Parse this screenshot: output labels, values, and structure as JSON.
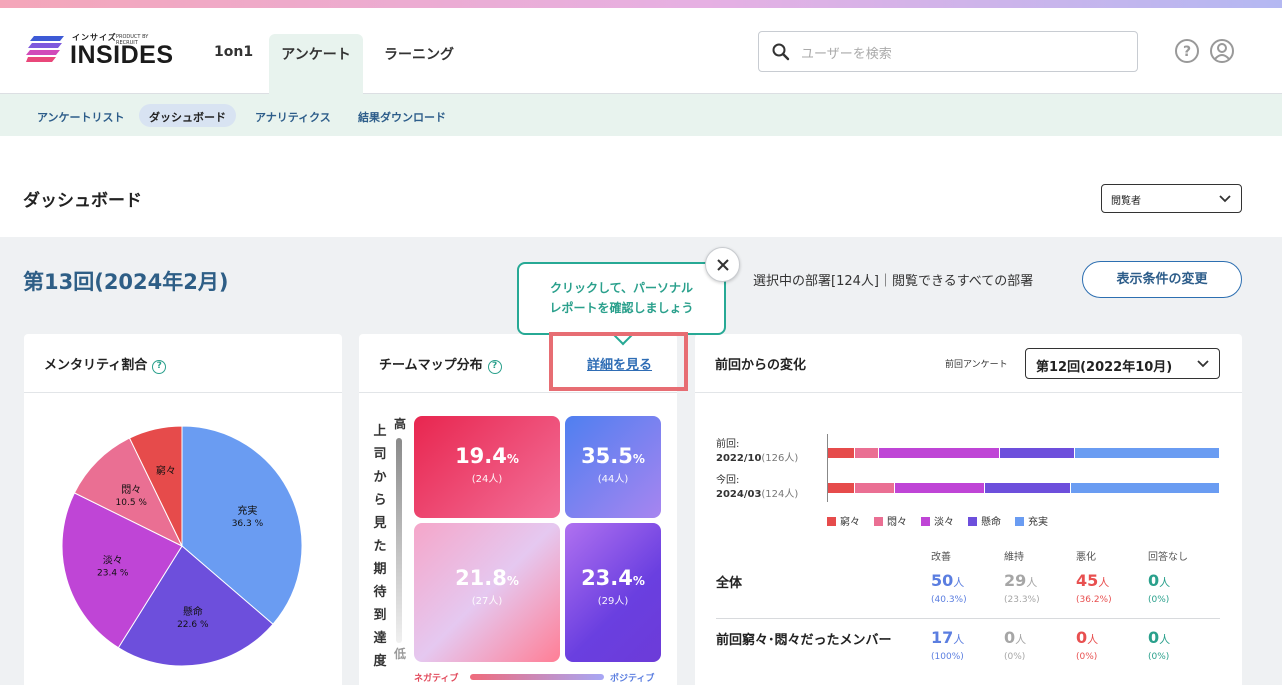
{
  "app": {
    "logo_kana": "インサイズ",
    "logo_word": "INSIDES",
    "logo_by": "PRODUCT BY RECRUIT"
  },
  "nav": {
    "tabs": [
      {
        "label": "1on1"
      },
      {
        "label": "アンケート"
      },
      {
        "label": "ラーニング"
      }
    ]
  },
  "search": {
    "placeholder": "ユーザーを検索"
  },
  "subnav": {
    "items": [
      {
        "label": "アンケートリスト"
      },
      {
        "label": "ダッシュボード"
      },
      {
        "label": "アナリティクス"
      },
      {
        "label": "結果ダウンロード"
      }
    ]
  },
  "page": {
    "title": "ダッシュボード",
    "viewer_select": "閲覧者",
    "round_title": "第13回(2024年2月)",
    "selection_info": "選択中の部署[124人]｜閲覧できるすべての部署",
    "change_button": "表示条件の変更"
  },
  "tooltip": {
    "line1": "クリックして、パーソナル",
    "line2": "レポートを確認しましょう"
  },
  "mentality": {
    "title": "メンタリティ割合",
    "slices": [
      {
        "label": "充実",
        "pct": "36.3 %",
        "value": 36.3,
        "color": "#6a9cf2"
      },
      {
        "label": "懸命",
        "pct": "22.6 %",
        "value": 22.6,
        "color": "#6d4fdc"
      },
      {
        "label": "淡々",
        "pct": "23.4 %",
        "value": 23.4,
        "color": "#bf45d6"
      },
      {
        "label": "悶々",
        "pct": "10.5 %",
        "value": 10.5,
        "color": "#ea6f93"
      },
      {
        "label": "窮々",
        "pct": "",
        "value": 7.2,
        "color": "#e64b4b"
      }
    ]
  },
  "teammap": {
    "title": "チームマップ分布",
    "detail_link": "詳細を見る",
    "axis_high": "高",
    "axis_low": "低",
    "axis_label": "上司から見た期待到達度",
    "neg_label": "ネガティブ",
    "pos_label": "ポジティブ",
    "cells": [
      {
        "pct": "19.4",
        "count": "(24人)"
      },
      {
        "pct": "35.5",
        "count": "(44人)"
      },
      {
        "pct": "21.8",
        "count": "(27人)"
      },
      {
        "pct": "23.4",
        "count": "(29人)"
      }
    ],
    "unit": "%"
  },
  "change": {
    "title": "前回からの変化",
    "prev_label": "前回アンケート",
    "prev_value": "第12回(2022年10月)",
    "bars": [
      {
        "label1": "前回:",
        "date": "2022/10",
        "n": "(126人)",
        "segments": [
          7,
          6,
          31,
          19,
          37
        ]
      },
      {
        "label1": "今回:",
        "date": "2024/03",
        "n": "(124人)",
        "segments": [
          7,
          10,
          23,
          22,
          38
        ]
      }
    ],
    "legend": [
      {
        "label": "窮々",
        "color": "#e64b4b"
      },
      {
        "label": "悶々",
        "color": "#ea6f93"
      },
      {
        "label": "淡々",
        "color": "#bf45d6"
      },
      {
        "label": "懸命",
        "color": "#6d4fdc"
      },
      {
        "label": "充実",
        "color": "#6a9cf2"
      }
    ],
    "columns": [
      "改善",
      "維持",
      "悪化",
      "回答なし"
    ],
    "rows": [
      {
        "label": "全体",
        "values": [
          {
            "n": "50",
            "u": "人",
            "p": "(40.3%)"
          },
          {
            "n": "29",
            "u": "人",
            "p": "(23.3%)"
          },
          {
            "n": "45",
            "u": "人",
            "p": "(36.2%)"
          },
          {
            "n": "0",
            "u": "人",
            "p": "(0%)"
          }
        ]
      },
      {
        "label": "前回窮々･悶々だったメンバー",
        "values": [
          {
            "n": "17",
            "u": "人",
            "p": "(100%)"
          },
          {
            "n": "0",
            "u": "人",
            "p": "(0%)"
          },
          {
            "n": "0",
            "u": "人",
            "p": "(0%)"
          },
          {
            "n": "0",
            "u": "人",
            "p": "(0%)"
          }
        ]
      }
    ],
    "colors": [
      "#5b7ee0",
      "#a6a6a6",
      "#e85050",
      "#2aa08c"
    ]
  }
}
